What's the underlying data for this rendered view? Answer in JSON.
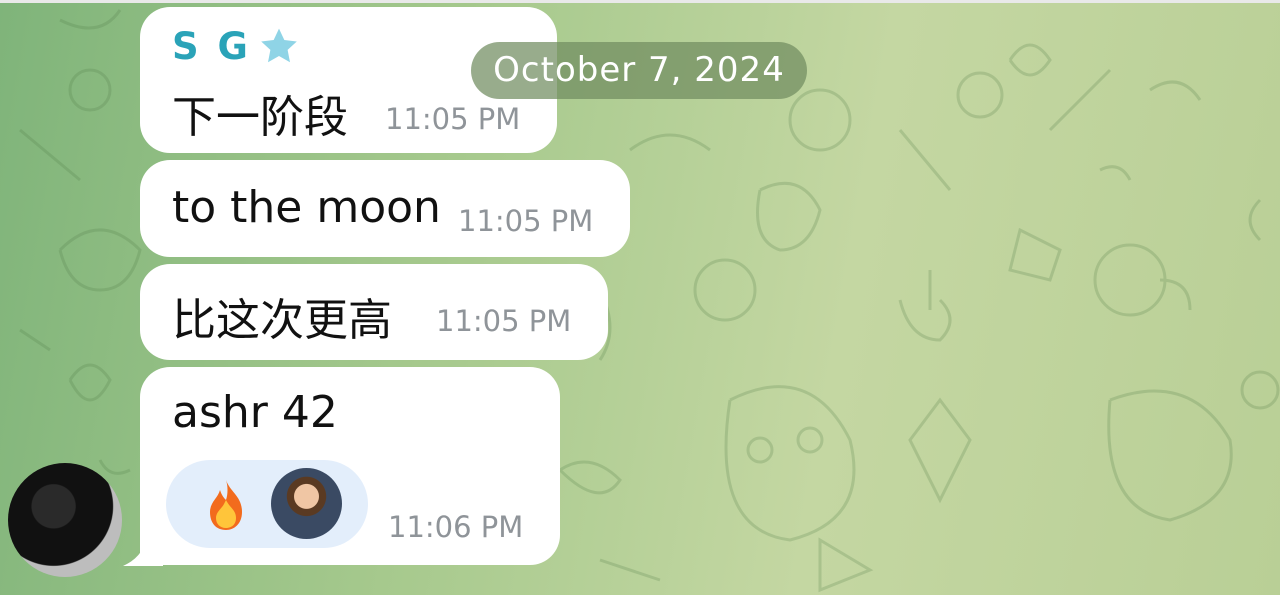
{
  "chat": {
    "date_separator": "October 7, 2024",
    "messages": [
      {
        "sender": "S G",
        "text": "下一阶段",
        "time": "11:05 PM",
        "sender_badge": "star-icon"
      },
      {
        "text": "to the moon",
        "time": "11:05 PM"
      },
      {
        "text": "比这次更高",
        "time": "11:05 PM"
      },
      {
        "text": "ashr 42",
        "time": "11:06 PM",
        "reactions": [
          {
            "emoji": "fire-icon"
          },
          {
            "avatar": "reactor-avatar"
          }
        ]
      }
    ]
  },
  "colors": {
    "sender_name": "#2aa3b8",
    "bubble": "#ffffff",
    "time_text": "#8f9499",
    "date_pill": "#708c5f",
    "reaction_bg": "#e3eefb"
  }
}
